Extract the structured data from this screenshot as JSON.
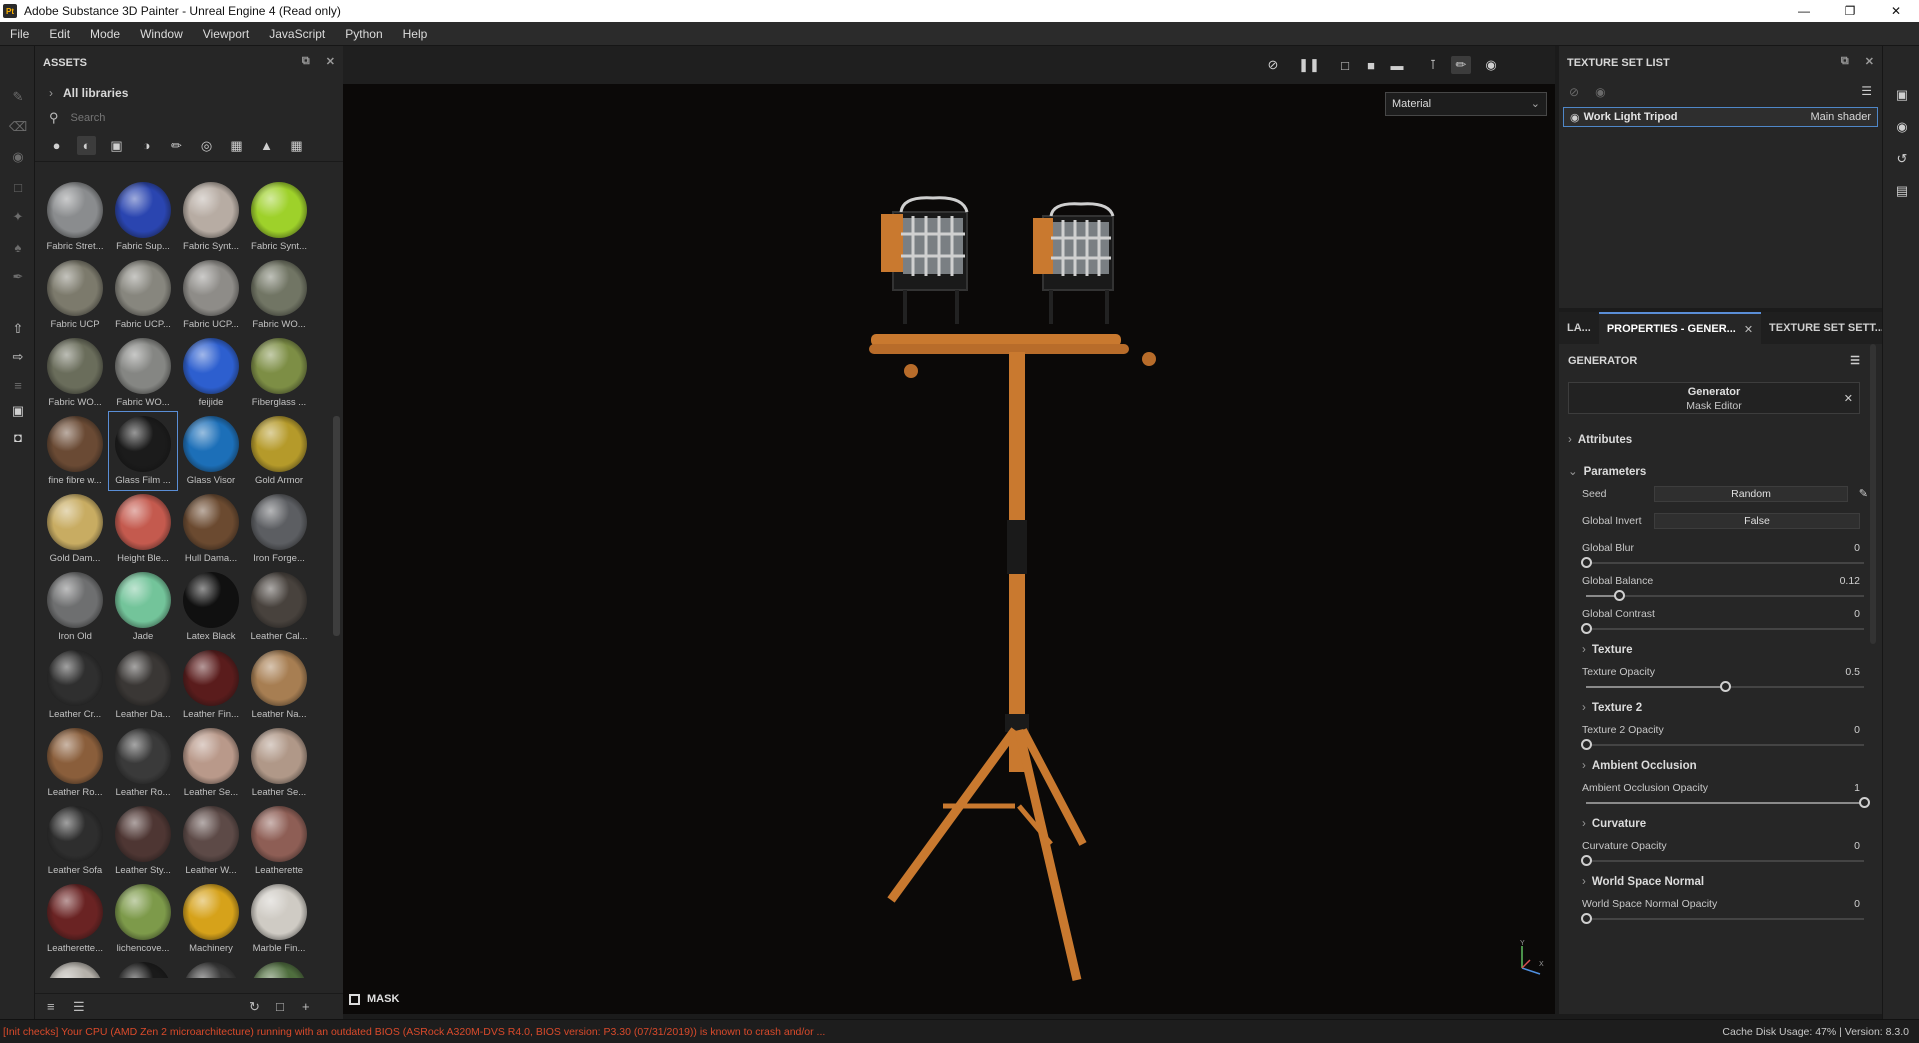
{
  "window": {
    "title": "Adobe Substance 3D Painter - Unreal Engine 4 (Read only)",
    "app_icon": "Pt"
  },
  "menu": [
    "File",
    "Edit",
    "Mode",
    "Window",
    "Viewport",
    "JavaScript",
    "Python",
    "Help"
  ],
  "assets": {
    "title": "ASSETS",
    "libraries_label": "All libraries",
    "search_placeholder": "Search",
    "materials": [
      {
        "label": "Fabric Stret...",
        "color": "#8a8c8e"
      },
      {
        "label": "Fabric Sup...",
        "color": "#2a45b0"
      },
      {
        "label": "Fabric Synt...",
        "color": "#b7aca3"
      },
      {
        "label": "Fabric Synt...",
        "color": "#9ed12a"
      },
      {
        "label": "Fabric UCP",
        "color": "#7c7a6c"
      },
      {
        "label": "Fabric UCP...",
        "color": "#87867e"
      },
      {
        "label": "Fabric UCP...",
        "color": "#8e8c88"
      },
      {
        "label": "Fabric WO...",
        "color": "#717564"
      },
      {
        "label": "Fabric WO...",
        "color": "#6a6d5b"
      },
      {
        "label": "Fabric WO...",
        "color": "#858683"
      },
      {
        "label": "feijide",
        "color": "#2d5fcf"
      },
      {
        "label": "Fiberglass ...",
        "color": "#7d8e45"
      },
      {
        "label": "fine fibre w...",
        "color": "#6a4a34"
      },
      {
        "label": "Glass Film ...",
        "color": "#1b1b1b"
      },
      {
        "label": "Glass Visor",
        "color": "#1c6fb8"
      },
      {
        "label": "Gold Armor",
        "color": "#b59a2a"
      },
      {
        "label": "Gold Dam...",
        "color": "#c8ac62"
      },
      {
        "label": "Height Ble...",
        "color": "#c45a4e"
      },
      {
        "label": "Hull Dama...",
        "color": "#6b4a30"
      },
      {
        "label": "Iron Forge...",
        "color": "#5c5e62"
      },
      {
        "label": "Iron Old",
        "color": "#6e6f70"
      },
      {
        "label": "Jade",
        "color": "#73c49a"
      },
      {
        "label": "Latex Black",
        "color": "#101010"
      },
      {
        "label": "Leather Cal...",
        "color": "#48423d"
      },
      {
        "label": "Leather Cr...",
        "color": "#2f2f2f"
      },
      {
        "label": "Leather Da...",
        "color": "#3a3735"
      },
      {
        "label": "Leather Fin...",
        "color": "#5a1c1c"
      },
      {
        "label": "Leather Na...",
        "color": "#a77e52"
      },
      {
        "label": "Leather Ro...",
        "color": "#8a5e3b"
      },
      {
        "label": "Leather Ro...",
        "color": "#3a3a3a"
      },
      {
        "label": "Leather Se...",
        "color": "#b9998a"
      },
      {
        "label": "Leather Se...",
        "color": "#b09888"
      },
      {
        "label": "Leather Sofa",
        "color": "#2e2e2e"
      },
      {
        "label": "Leather Sty...",
        "color": "#4e3633"
      },
      {
        "label": "Leather W...",
        "color": "#5d4a47"
      },
      {
        "label": "Leatherette",
        "color": "#8e5e55"
      },
      {
        "label": "Leatherette...",
        "color": "#6a2323"
      },
      {
        "label": "lichencove...",
        "color": "#7d9a4a"
      },
      {
        "label": "Machinery",
        "color": "#d6a21a"
      },
      {
        "label": "Marble Fin...",
        "color": "#cfcbc4"
      },
      {
        "label": "",
        "color": "#b5b1aa"
      },
      {
        "label": "",
        "color": "#1a1a1a"
      },
      {
        "label": "",
        "color": "#3a3a3a"
      },
      {
        "label": "",
        "color": "#4f6e3e"
      }
    ],
    "selected_index": 13
  },
  "viewport": {
    "display_select": "Material",
    "mask_label": "MASK",
    "axis_y": "Y",
    "axis_x": "X",
    "toolbar_icons": [
      "hide-icon",
      "pause-icon",
      "2d-view-icon",
      "3d-view-icon",
      "camera-icon",
      "symmetry-icon",
      "paint-brush-icon",
      "screenshot-icon"
    ]
  },
  "texture_set_list": {
    "title": "TEXTURE SET LIST",
    "row_name": "Work Light Tripod",
    "row_shader": "Main shader"
  },
  "tabs": [
    {
      "label": "LA..."
    },
    {
      "label": "PROPERTIES - GENER..."
    },
    {
      "label": "TEXTURE SET SETT..."
    }
  ],
  "properties": {
    "section_title": "GENERATOR",
    "generator_name": "Generator",
    "generator_type": "Mask Editor",
    "attributes_label": "Attributes",
    "parameters_label": "Parameters",
    "seed_label": "Seed",
    "seed_value": "Random",
    "global_invert_label": "Global Invert",
    "global_invert_value": "False",
    "params": [
      {
        "label": "Global Blur",
        "value": "0",
        "fraction": 0
      },
      {
        "label": "Global Balance",
        "value": "0.12",
        "fraction": 0.12
      },
      {
        "label": "Global Contrast",
        "value": "0",
        "fraction": 0
      }
    ],
    "groups": [
      {
        "title": "Texture",
        "param_label": "Texture Opacity",
        "value": "0.5",
        "fraction": 0.5
      },
      {
        "title": "Texture 2",
        "param_label": "Texture 2 Opacity",
        "value": "0",
        "fraction": 0
      },
      {
        "title": "Ambient Occlusion",
        "param_label": "Ambient Occlusion Opacity",
        "value": "1",
        "fraction": 1
      },
      {
        "title": "Curvature",
        "param_label": "Curvature Opacity",
        "value": "0",
        "fraction": 0
      },
      {
        "title": "World Space Normal",
        "param_label": "World Space Normal Opacity",
        "value": "0",
        "fraction": 0
      }
    ]
  },
  "status": {
    "message": "[Init checks] Your CPU (AMD Zen 2 microarchitecture) running with an outdated BIOS (ASRock A320M-DVS R4.0, BIOS version: P3.30 (07/31/2019)) is known to crash and/or ...",
    "right": "Cache Disk Usage:  47% | Version: 8.3.0"
  },
  "colors": {
    "accent": "#5a8ed6",
    "warning": "#d94a2b",
    "tripod": "#c9792f"
  }
}
